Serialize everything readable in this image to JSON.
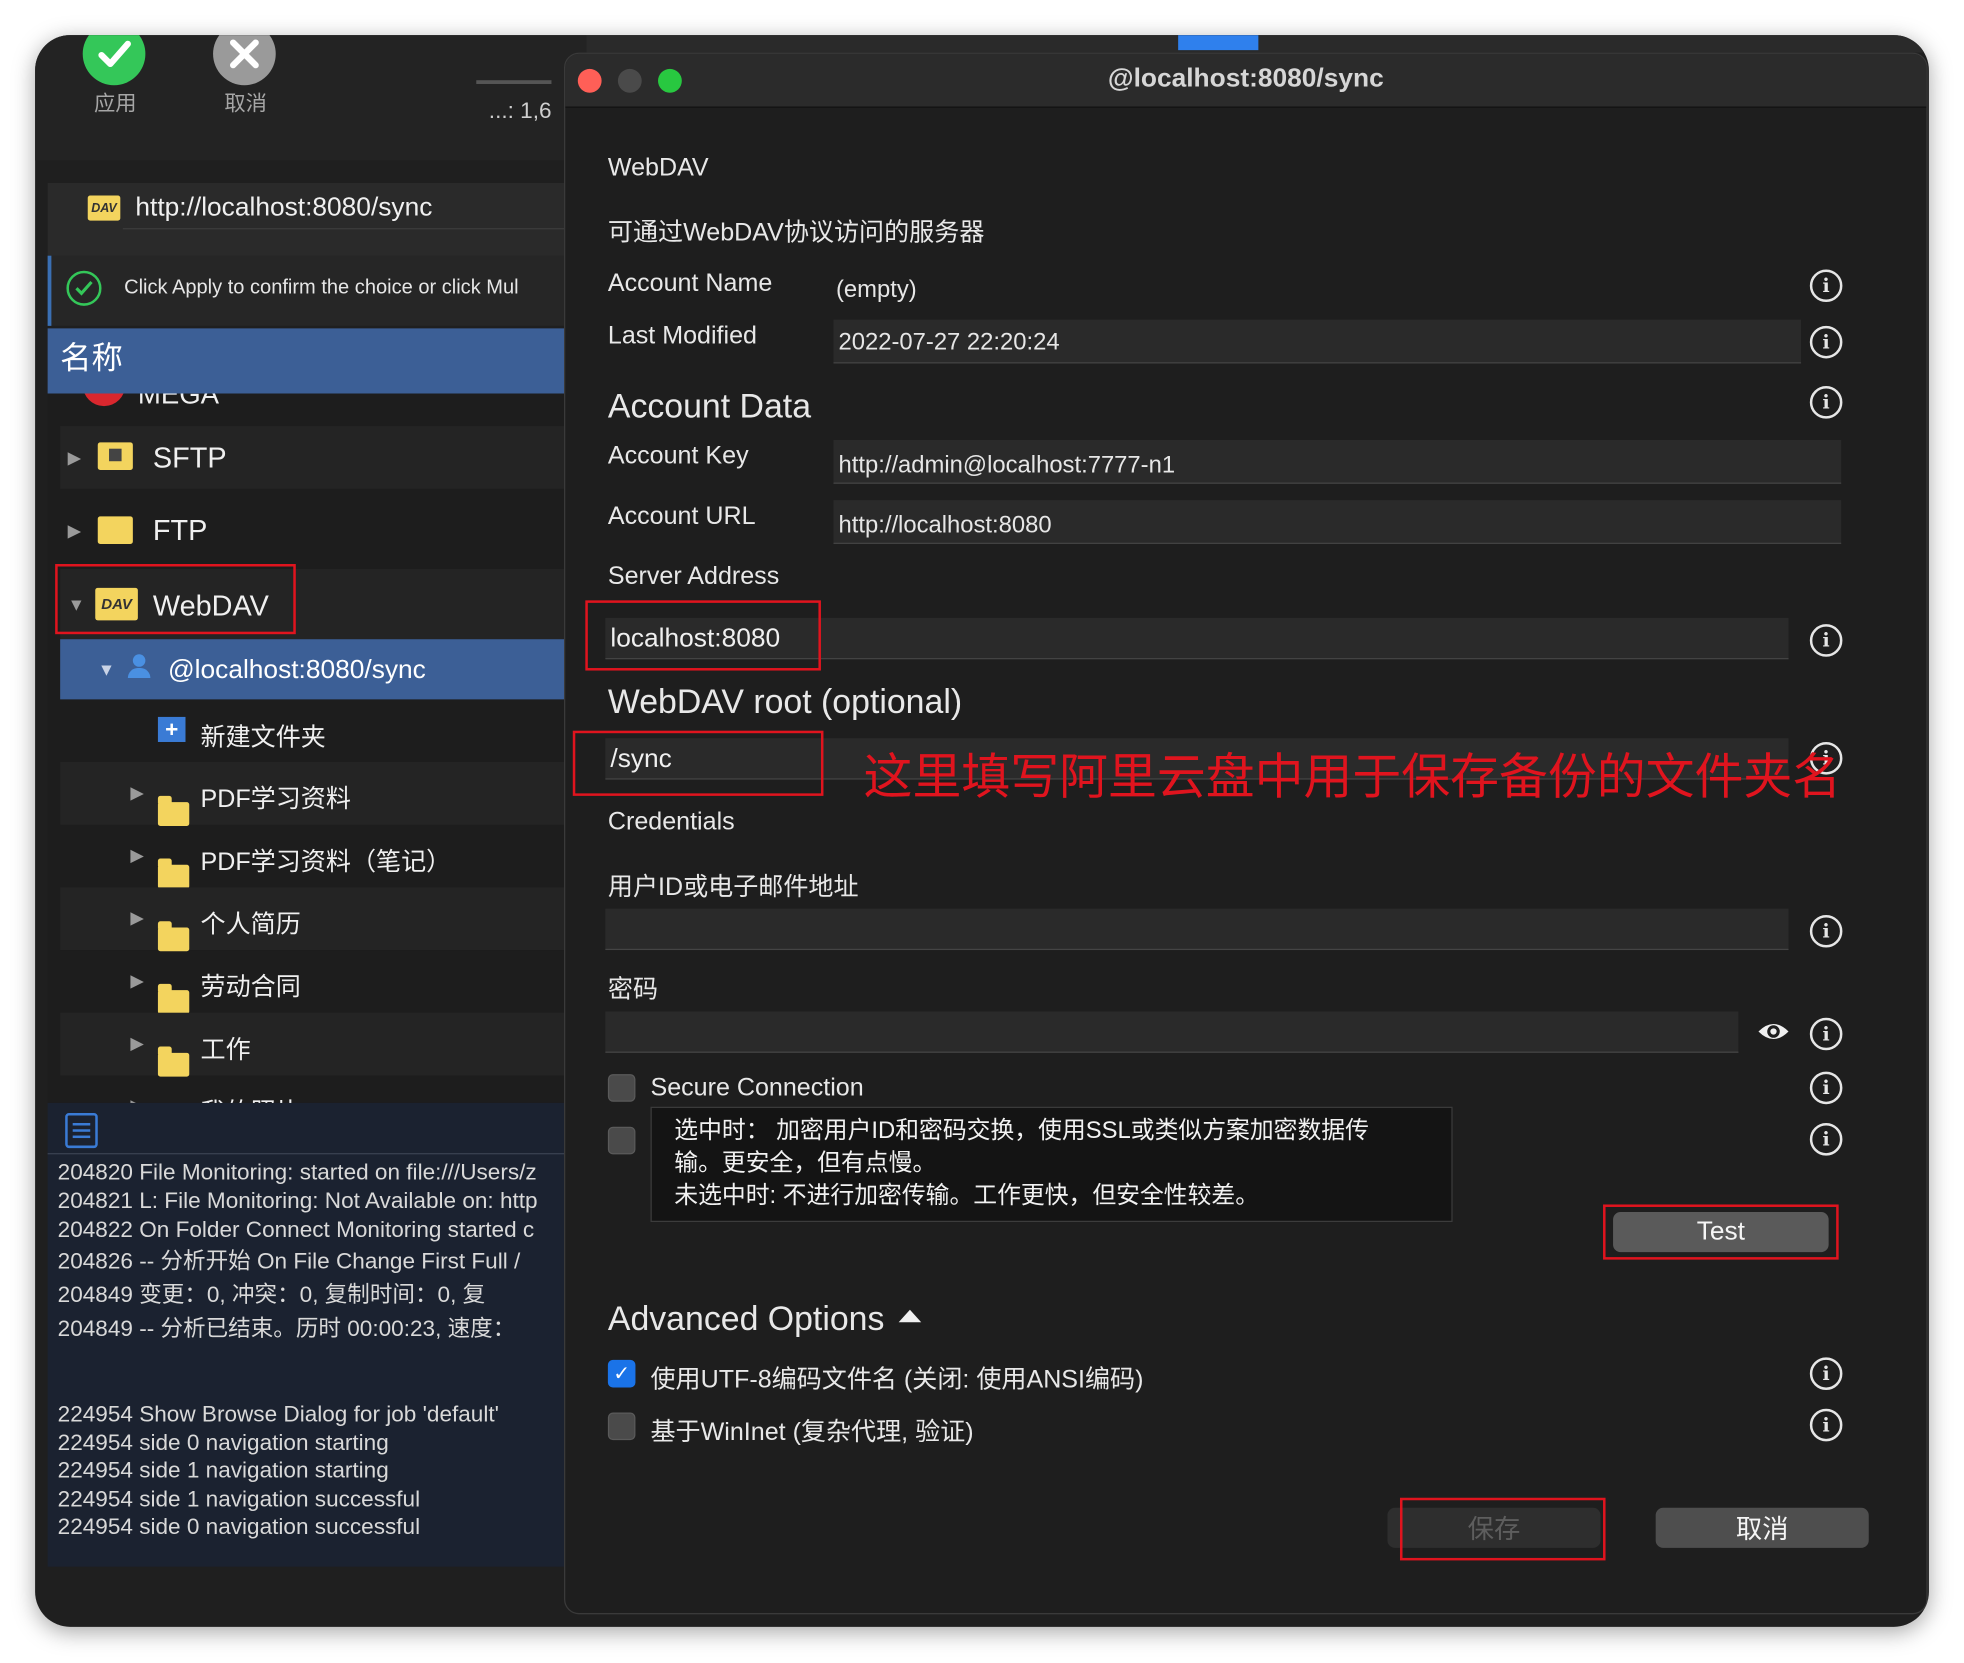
{
  "toolbar": {
    "apply_label": "应用",
    "cancel_label": "取消",
    "counter": "...: 1,6"
  },
  "left": {
    "path_url": "http://localhost:8080/sync",
    "hint": "Click Apply to confirm the choice or click Mul",
    "header": "名称",
    "tree": {
      "mega": "MEGA",
      "sftp": "SFTP",
      "ftp": "FTP",
      "webdav": "WebDAV",
      "account": "@localhost:8080/sync",
      "new_folder": "新建文件夹",
      "folders": [
        "PDF学习资料",
        "PDF学习资料（笔记）",
        "个人简历",
        "劳动合同",
        "工作",
        "我的照片"
      ]
    },
    "log": [
      "204820 File Monitoring: started on file:///Users/z",
      "204821 L: File Monitoring: Not Available on: http",
      "204822 On Folder Connect Monitoring started c",
      "204826 -- 分析开始 On File Change First Full /",
      "204849 变更：0,   冲突：0,   复制时间：0,   复",
      "204849 -- 分析已结束。历时 00:00:23, 速度：",
      "224954 Show Browse Dialog for job 'default'",
      "224954 side 0 navigation starting",
      "224954 side 1 navigation starting",
      "224954 side 1 navigation successful",
      "224954 side 0 navigation successful"
    ]
  },
  "dialog": {
    "title": "@localhost:8080/sync",
    "service_name": "WebDAV",
    "service_desc": "可通过WebDAV协议访问的服务器",
    "account_name_label": "Account Name",
    "account_name_value": "(empty)",
    "last_modified_label": "Last Modified",
    "last_modified_value": "2022-07-27 22:20:24",
    "account_data_title": "Account Data",
    "account_key_label": "Account Key",
    "account_key_value": "http://admin@localhost:7777-n1",
    "account_url_label": "Account URL",
    "account_url_value": "http://localhost:8080",
    "server_address_label": "Server Address",
    "server_address_value": "localhost:8080",
    "webdav_root_title": "WebDAV root (optional)",
    "webdav_root_value": "/sync",
    "annotation": "这里填写阿里云盘中用于保存备份的文件夹名",
    "credentials_label": "Credentials",
    "user_label": "用户ID或电子邮件地址",
    "user_value": "",
    "password_label": "密码",
    "password_value": "",
    "secure_label": "Secure Connection",
    "secure_checked": false,
    "tooltip": "选中时：  加密用户ID和密码交换，使用SSL或类似方案加密数据传\n输。更安全，但有点慢。\n未选中时: 不进行加密传输。工作更快，但安全性较差。",
    "test_label": "Test",
    "advanced_title": "Advanced Options",
    "utf8_label": "使用UTF-8编码文件名 (关闭: 使用ANSI编码)",
    "utf8_checked": true,
    "wininet_label": "基于WinInet (复杂代理, 验证)",
    "wininet_checked": false,
    "save_label": "保存",
    "cancel_label": "取消"
  },
  "colors": {
    "accent": "#1a73e8",
    "selection": "#3c5f96",
    "annotation_red": "#e0141e",
    "apply_green": "#34c759"
  }
}
